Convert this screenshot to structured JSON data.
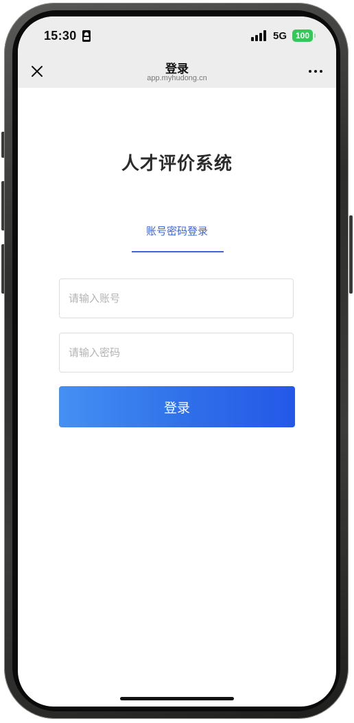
{
  "status_bar": {
    "time": "15:30",
    "network": "5G",
    "battery": "100"
  },
  "nav_bar": {
    "title": "登录",
    "url": "app.myhudong.cn"
  },
  "login": {
    "app_title": "人才评价系统",
    "tab_label": "账号密码登录",
    "account_placeholder": "请输入账号",
    "password_placeholder": "请输入密码",
    "submit_label": "登录"
  },
  "colors": {
    "accent": "#3d64d8",
    "button_gradient_start": "#4590f3",
    "button_gradient_end": "#2458e8",
    "battery_green": "#34c759",
    "header_bg": "#ededed"
  },
  "icons": {
    "close": "close-icon",
    "more": "more-icon",
    "signal": "signal-icon",
    "badge": "id-badge-icon"
  }
}
